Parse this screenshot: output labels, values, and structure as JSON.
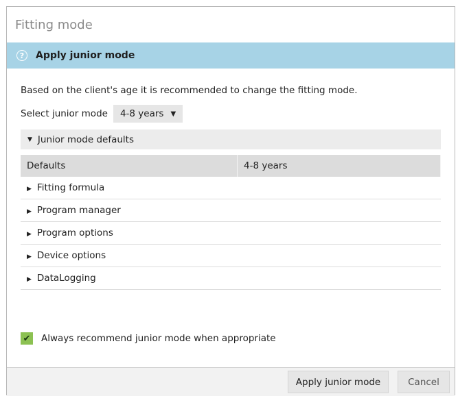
{
  "dialog": {
    "title": "Fitting mode"
  },
  "banner": {
    "icon": "help-icon",
    "text": "Apply junior mode"
  },
  "description": "Based on the client's age it is recommended to change the fitting mode.",
  "select": {
    "label": "Select junior mode",
    "value": "4-8 years"
  },
  "section": {
    "title": "Junior mode defaults",
    "table": {
      "headers": [
        "Defaults",
        "4-8 years"
      ],
      "rows": [
        "Fitting formula",
        "Program manager",
        "Program options",
        "Device options",
        "DataLogging"
      ]
    }
  },
  "checkbox": {
    "checked": true,
    "label": "Always recommend junior mode when appropriate"
  },
  "buttons": {
    "apply": "Apply junior mode",
    "cancel": "Cancel"
  },
  "colors": {
    "banner": "#a7d3e6",
    "checkbox": "#8cc152"
  }
}
